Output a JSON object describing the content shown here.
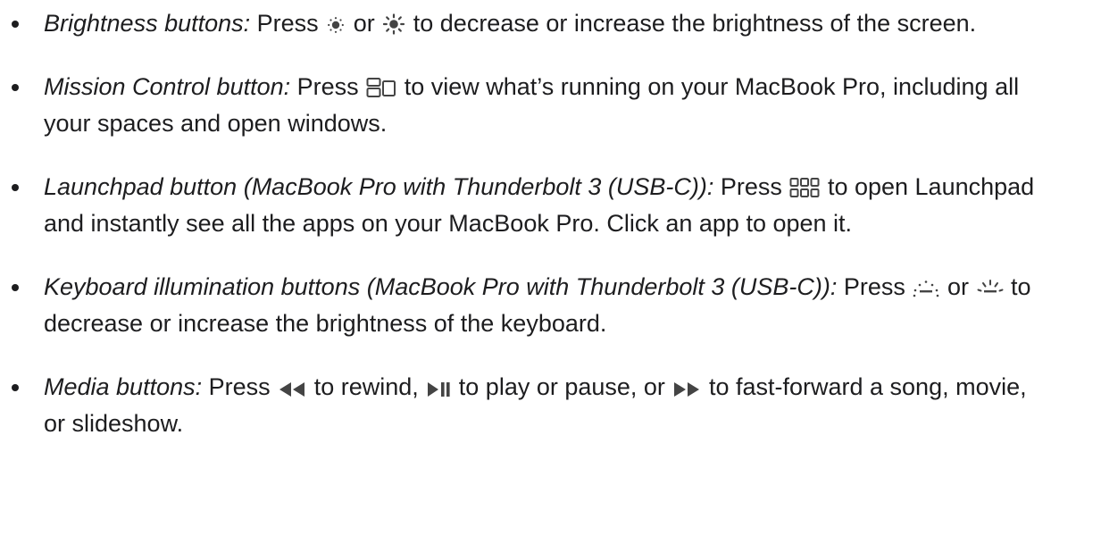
{
  "items": [
    {
      "term": "Brightness buttons:",
      "parts": [
        "Press",
        "or",
        "to decrease or increase the brightness of the screen."
      ],
      "icons": [
        "brightness-down-icon",
        "brightness-up-icon"
      ]
    },
    {
      "term": "Mission Control button:",
      "parts": [
        "Press",
        "to view what’s running on your MacBook Pro, including all your spaces and open windows."
      ],
      "icons": [
        "mission-control-icon"
      ]
    },
    {
      "term": "Launchpad button (MacBook Pro with Thunderbolt 3 (USB-C)):",
      "parts": [
        "Press",
        "to open Launchpad and instantly see all the apps on your MacBook Pro. Click an app to open it."
      ],
      "icons": [
        "launchpad-icon"
      ]
    },
    {
      "term": "Keyboard illumination buttons (MacBook Pro with Thunderbolt 3 (USB-C)):",
      "parts": [
        "Press",
        "or",
        "to decrease or increase the brightness of the keyboard."
      ],
      "icons": [
        "keyboard-brightness-down-icon",
        "keyboard-brightness-up-icon"
      ]
    },
    {
      "term": "Media buttons:",
      "parts": [
        "Press",
        "to rewind,",
        "to play or pause, or",
        "to fast-forward a song, movie, or slideshow."
      ],
      "icons": [
        "rewind-icon",
        "play-pause-icon",
        "fast-forward-icon"
      ]
    }
  ],
  "colors": {
    "text": "#1d1d1f",
    "icon": "#444444",
    "background": "#ffffff"
  }
}
